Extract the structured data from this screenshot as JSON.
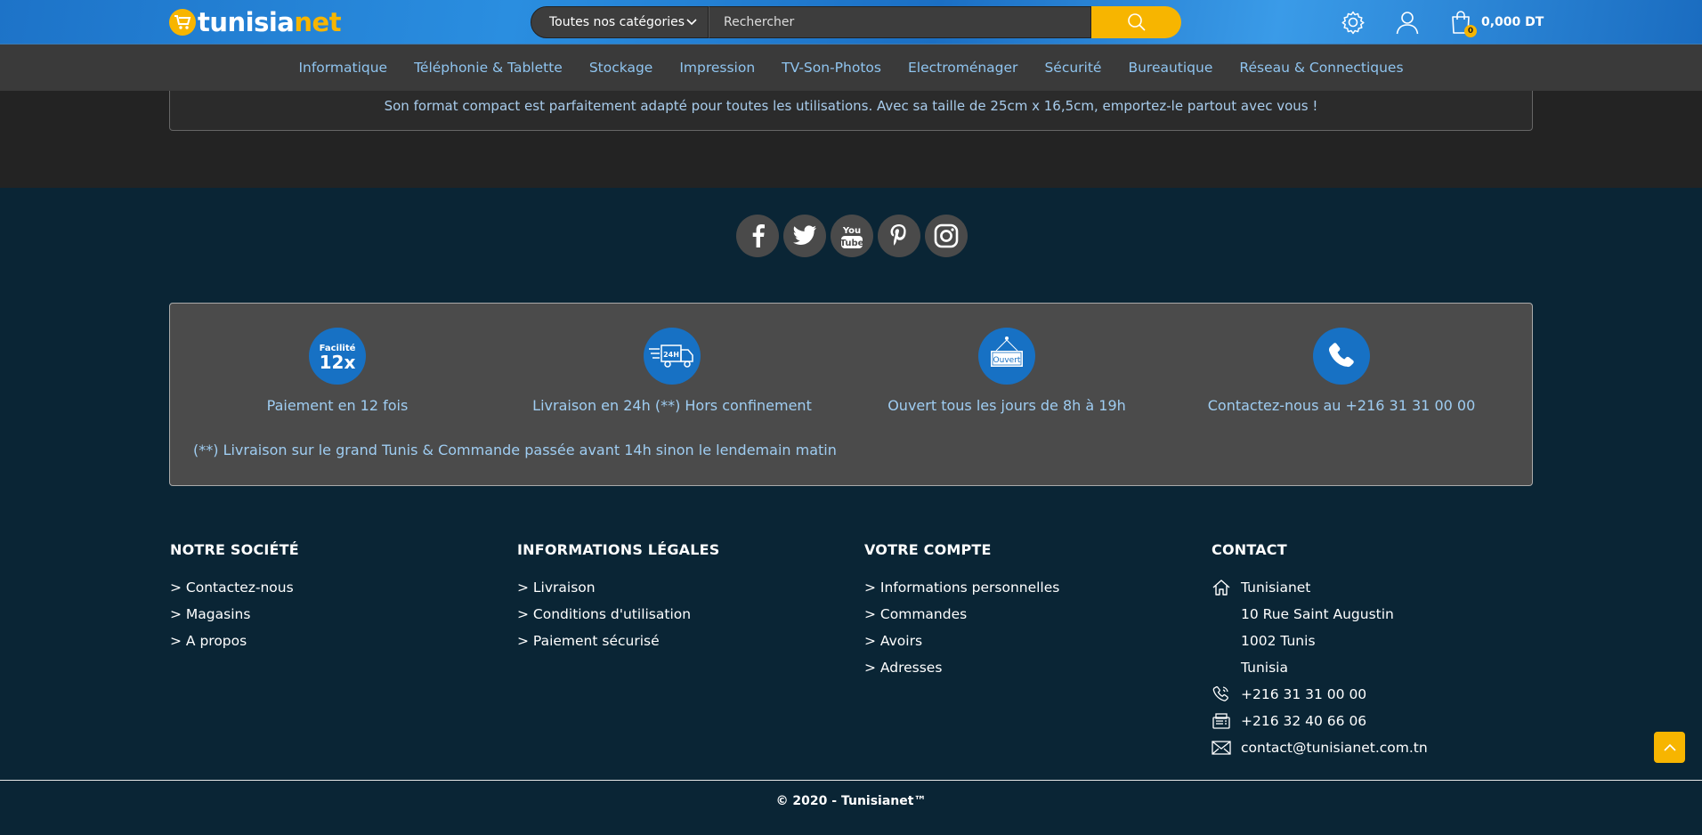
{
  "header": {
    "logo_part1": "tunisia",
    "logo_part2": "net",
    "category_select": "Toutes nos catégories",
    "search_placeholder": "Rechercher",
    "cart_count": "0",
    "cart_total": "0,000 DT"
  },
  "nav": {
    "items": [
      "Informatique",
      "Téléphonie & Tablette",
      "Stockage",
      "Impression",
      "TV-Son-Photos",
      "Electroménager",
      "Sécurité",
      "Bureautique",
      "Réseau & Connectiques"
    ]
  },
  "product": {
    "description": "Son format compact est parfaitement adapté pour toutes les utilisations. Avec sa taille de 25cm x 16,5cm, emportez-le partout avec vous !"
  },
  "social": [
    "facebook-icon",
    "twitter-icon",
    "youtube-icon",
    "pinterest-icon",
    "instagram-icon"
  ],
  "features": {
    "items": [
      {
        "icon": "facilite-12x-icon",
        "icon_top": "Facilité",
        "icon_main": "12x",
        "label": "Paiement en 12 fois"
      },
      {
        "icon": "delivery-24h-icon",
        "icon_main": "24H",
        "label": "Livraison en 24h (**) Hors confinement"
      },
      {
        "icon": "open-sign-icon",
        "icon_main": "Ouvert",
        "label": "Ouvert tous les jours de 8h à 19h"
      },
      {
        "icon": "phone-icon",
        "label": "Contactez-nous au +216 31 31 00 00"
      }
    ],
    "note": "(**) Livraison sur le grand Tunis & Commande passée avant 14h sinon le lendemain matin"
  },
  "footer": {
    "societe": {
      "title": "NOTRE SOCIÉTÉ",
      "links": [
        "> Contactez-nous",
        "> Magasins",
        "> A propos"
      ]
    },
    "legal": {
      "title": "INFORMATIONS LÉGALES",
      "links": [
        "> Livraison",
        "> Conditions d'utilisation",
        "> Paiement sécurisé"
      ]
    },
    "compte": {
      "title": "VOTRE COMPTE",
      "links": [
        "> Informations personnelles",
        "> Commandes",
        "> Avoirs",
        "> Adresses"
      ]
    },
    "contact": {
      "title": "CONTACT",
      "name": "Tunisianet",
      "street": "10 Rue Saint Augustin",
      "city": "1002 Tunis",
      "country": "Tunisia",
      "phone": "+216 31 31 00 00",
      "fax": "+216 32 40 66 06",
      "email": "contact@tunisianet.com.tn"
    },
    "copyright": "© 2020 - Tunisianet™"
  },
  "colors": {
    "accent": "#f7b500",
    "blue": "#1771c4",
    "footer_bg": "#0a2535",
    "link": "#8fc4ef"
  }
}
